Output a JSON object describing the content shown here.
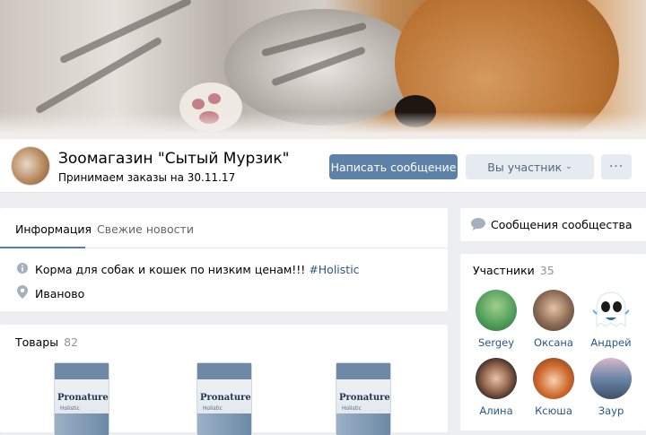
{
  "group": {
    "name": "Зоомагазин \"Сытый Мурзик\"",
    "status": "Принимаем заказы на 30.11.17"
  },
  "actions": {
    "message_label": "Написать сообщение",
    "member_label": "Вы участник",
    "more_label": "···"
  },
  "info": {
    "tabs": [
      "Информация",
      "Свежие новости"
    ],
    "description": "Корма для собак и кошек по низким ценам!!!",
    "hashtag": "#Holistic",
    "location": "Иваново"
  },
  "products": {
    "title": "Товары",
    "count": "82",
    "items": [
      {
        "brand": "Pronature",
        "line": "Holistic"
      },
      {
        "brand": "Pronature",
        "line": "Holistic"
      },
      {
        "brand": "Pronature",
        "line": "Holistic"
      }
    ]
  },
  "sidebar": {
    "messages_label": "Сообщения сообщества",
    "members_title": "Участники",
    "members_count": "35",
    "members": [
      {
        "name": "Sergey",
        "color": "#4f9b5a"
      },
      {
        "name": "Оксана",
        "color": "#8a6a55"
      },
      {
        "name": "Андрей",
        "color": "#ffffff"
      },
      {
        "name": "Алина",
        "color": "#3b2a25"
      },
      {
        "name": "Ксюша",
        "color": "#d06a2e"
      },
      {
        "name": "Заур",
        "color": "#6b86a8"
      }
    ]
  },
  "colors": {
    "accent": "#5e81a8",
    "link": "#2a5885",
    "background": "#edeef0"
  }
}
